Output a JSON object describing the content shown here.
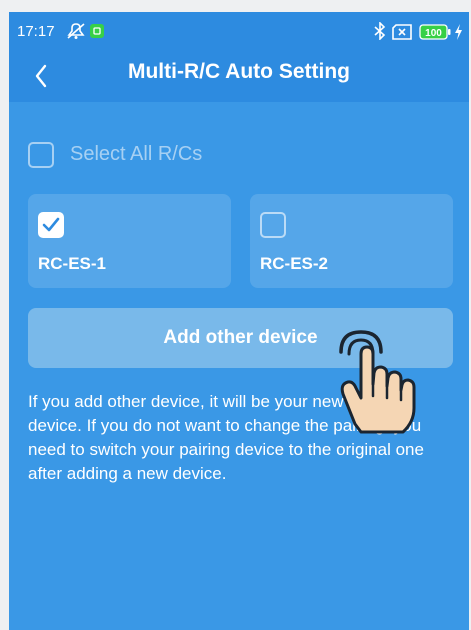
{
  "status_bar": {
    "time": "17:17",
    "battery": "100",
    "icons": [
      "mute-icon",
      "app-notification-icon",
      "bluetooth-icon",
      "sim-off-icon",
      "battery-icon",
      "charging-icon"
    ]
  },
  "header": {
    "title": "Multi-R/C Auto Setting",
    "back_icon": "chevron-left-icon"
  },
  "select_all": {
    "label": "Select All R/Cs",
    "checked": false
  },
  "devices": [
    {
      "name": "RC-ES-1",
      "checked": true
    },
    {
      "name": "RC-ES-2",
      "checked": false
    }
  ],
  "add_button": {
    "label": "Add other device"
  },
  "info_text": "If you add other device, it will be your new pairing device. If you do not want to change the pairing, you need to switch your pairing device to the original one after adding a new device.",
  "overlay": {
    "icon": "tap-hand-icon"
  },
  "colors": {
    "header_bg": "#2d8be0",
    "content_bg": "#3a98e6",
    "button_bg": "#79b9ea",
    "battery_green": "#37d046"
  }
}
